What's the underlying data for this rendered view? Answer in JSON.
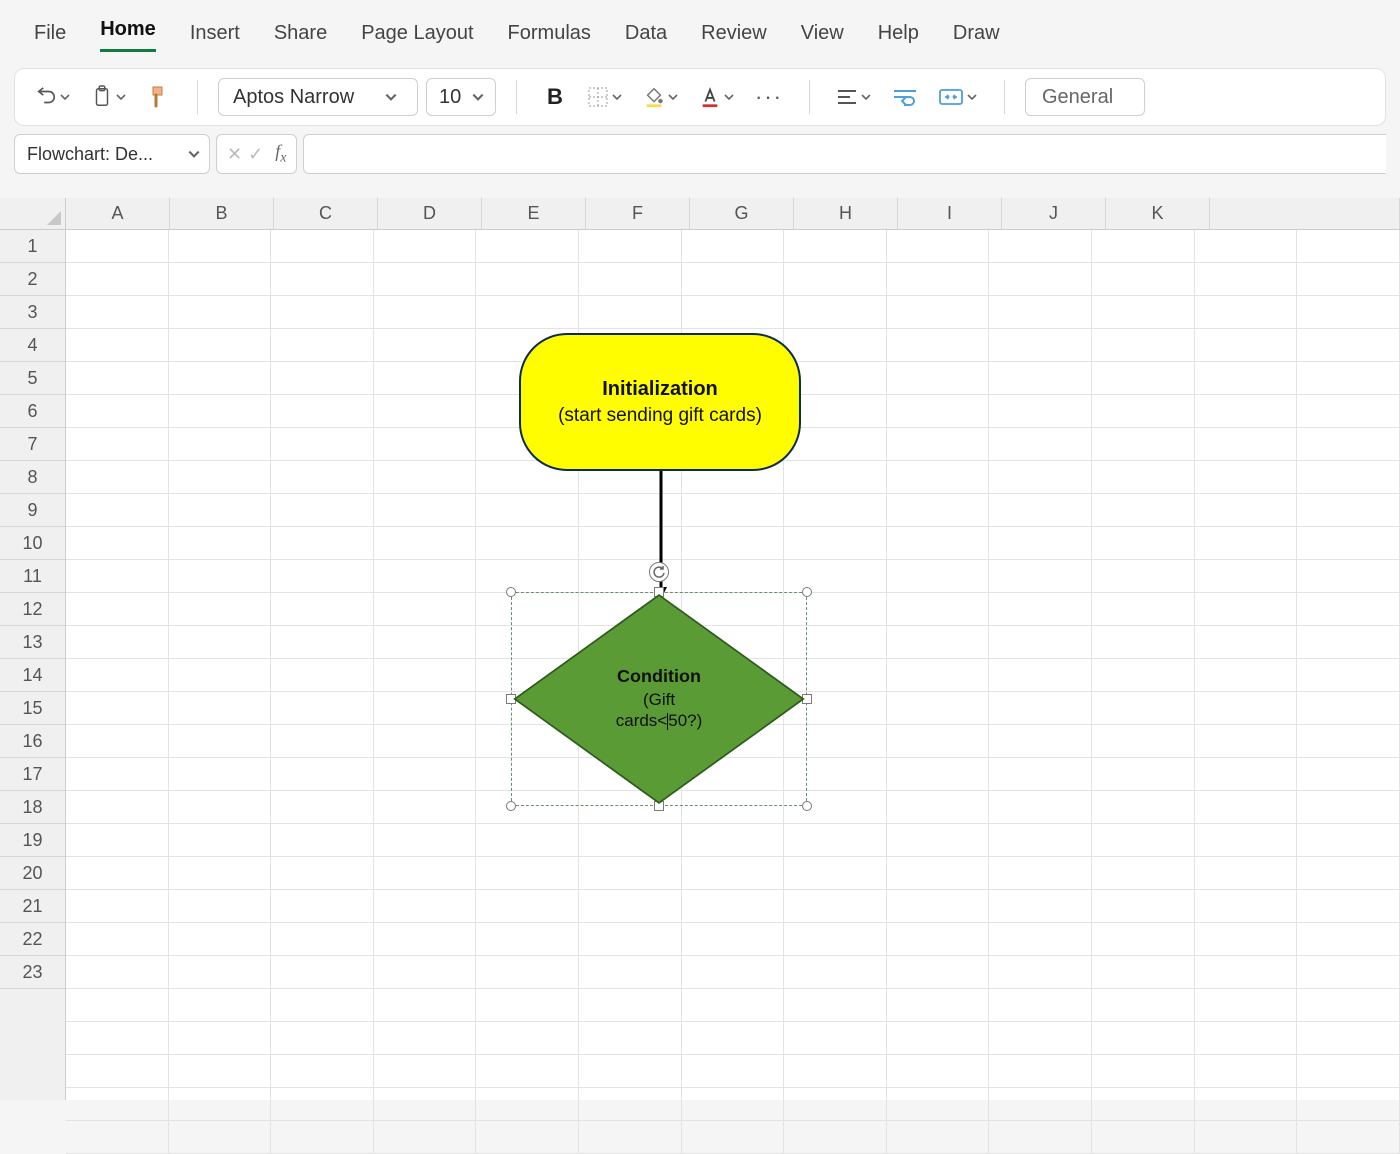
{
  "tabs": [
    "File",
    "Home",
    "Insert",
    "Share",
    "Page Layout",
    "Formulas",
    "Data",
    "Review",
    "View",
    "Help",
    "Draw"
  ],
  "active_tab": "Home",
  "toolbar": {
    "font_name": "Aptos Narrow",
    "font_size": "10",
    "number_format": "General"
  },
  "name_box": "Flowchart: De...",
  "formula_bar": "",
  "columns": [
    "A",
    "B",
    "C",
    "D",
    "E",
    "F",
    "G",
    "H",
    "I",
    "J",
    "K"
  ],
  "row_count": 23,
  "shapes": {
    "terminator": {
      "title": "Initialization",
      "subtitle": "(start sending gift cards)"
    },
    "decision": {
      "title": "Condition",
      "line2a": "(Gift",
      "line2b_before": "cards<",
      "line2b_after": "50?)"
    }
  }
}
